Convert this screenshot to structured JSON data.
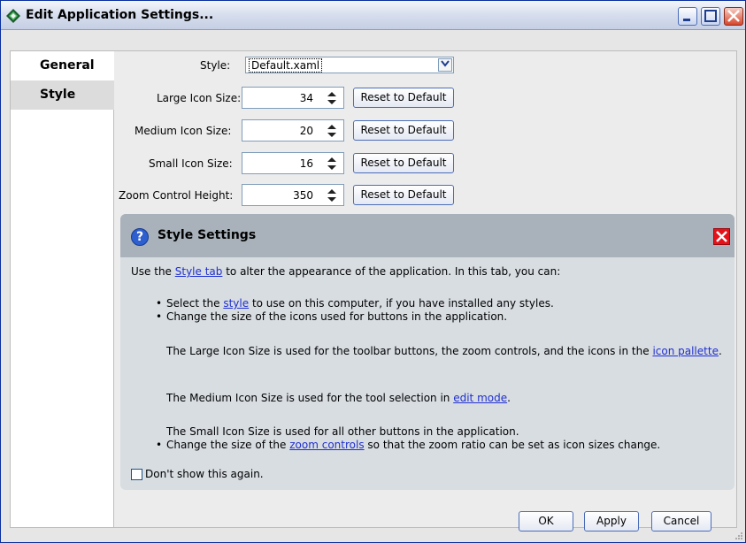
{
  "window": {
    "title": "Edit Application Settings..."
  },
  "tabs": [
    {
      "label": "General"
    },
    {
      "label": "Style"
    }
  ],
  "form": {
    "style_label": "Style:",
    "style_value": "Default.xaml",
    "large_label": "Large Icon Size:",
    "large_value": "34",
    "medium_label": "Medium Icon Size:",
    "medium_value": "20",
    "small_label": "Small Icon Size:",
    "small_value": "16",
    "zoom_label": "Zoom Control Height:",
    "zoom_value": "350",
    "reset_label": "Reset to Default"
  },
  "panel": {
    "title": "Style Settings",
    "intro_pre": "Use the ",
    "intro_link": "Style tab",
    "intro_post": " to alter the appearance of the application. In this tab, you can:",
    "b1_pre": "Select the ",
    "b1_link": "style",
    "b1_post": " to use on this computer, if you have installed any styles.",
    "b2": "Change the size of the icons used for buttons in the application.",
    "large_pre": "The Large Icon Size is used for the toolbar buttons, the zoom controls, and the icons in the ",
    "large_link": "icon pallette",
    "large_post": ".",
    "medium_pre": "The Medium Icon Size is used for the tool selection in ",
    "medium_link": "edit mode",
    "medium_post": ".",
    "small_text": "The Small Icon Size is used for all other buttons in the application.",
    "b3_pre": "Change the size of the ",
    "b3_link": "zoom controls",
    "b3_post": " so that the zoom ratio can be set as icon sizes change.",
    "checkbox_label": "Don't show this again."
  },
  "footer": {
    "ok_label": "OK",
    "apply_label": "Apply",
    "cancel_label": "Cancel"
  },
  "colors": {
    "link": "#1f2fd0",
    "close_red": "#e5121a",
    "panel_header": "#a9b2ba",
    "help_blue": "#2e5fd0"
  }
}
